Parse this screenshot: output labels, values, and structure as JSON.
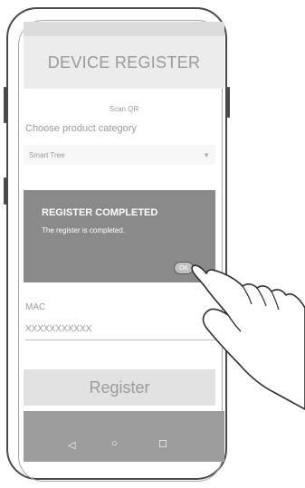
{
  "screen": {
    "title": "DEVICE REGISTER",
    "scan_qr": "Scan QR",
    "choose_category_label": "Choose product category",
    "product_select": {
      "selected": "Smart Tree"
    }
  },
  "dialog": {
    "title": "REGISTER COMPLETED",
    "message": "The register is completed.",
    "ok_label": "OK"
  },
  "mac": {
    "label": "MAC",
    "value": "XXXXXXXXXXX"
  },
  "register_button": "Register",
  "nav": {
    "back_glyph": "◁",
    "home_glyph": "○",
    "recents_glyph": "☐"
  },
  "icons": [
    "chevron-down-icon",
    "back-icon",
    "home-icon",
    "recents-icon",
    "pointing-hand-icon"
  ],
  "colors": {
    "dialog_bg": "#8a8a8a",
    "title_bar_bg": "#ececec",
    "nav_bar_bg": "#9d9d9d",
    "text_grey": "#9a9a9a"
  }
}
